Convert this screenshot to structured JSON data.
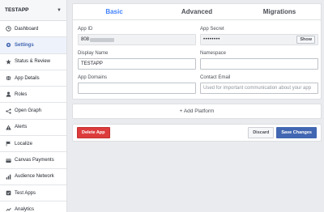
{
  "sidebar": {
    "app_name": "TESTAPP",
    "items": [
      {
        "label": "Dashboard",
        "icon": "clock-icon"
      },
      {
        "label": "Settings",
        "icon": "gear-icon",
        "active": true
      },
      {
        "label": "Status & Review",
        "icon": "star-icon"
      },
      {
        "label": "App Details",
        "icon": "globe-icon"
      },
      {
        "label": "Roles",
        "icon": "person-icon"
      },
      {
        "label": "Open Graph",
        "icon": "open-graph-icon"
      },
      {
        "label": "Alerts",
        "icon": "warning-icon"
      },
      {
        "label": "Localize",
        "icon": "flag-icon"
      },
      {
        "label": "Canvas Payments",
        "icon": "card-icon"
      },
      {
        "label": "Audience Network",
        "icon": "chart-icon"
      },
      {
        "label": "Test Apps",
        "icon": "test-apps-icon"
      },
      {
        "label": "Analytics",
        "icon": "analytics-icon"
      }
    ]
  },
  "tabs": [
    "Basic",
    "Advanced",
    "Migrations"
  ],
  "form": {
    "app_id_label": "App ID",
    "app_id_value": "808",
    "app_secret_label": "App Secret",
    "app_secret_value": "••••••••",
    "show_label": "Show",
    "display_name_label": "Display Name",
    "display_name_value": "TESTAPP",
    "namespace_label": "Namespace",
    "namespace_value": "",
    "app_domains_label": "App Domains",
    "app_domains_value": "",
    "contact_email_label": "Contact Email",
    "contact_email_placeholder": "Used for important communication about your app"
  },
  "add_platform": "+ Add Platform",
  "footer": {
    "delete": "Delete App",
    "discard": "Discard",
    "save": "Save Changes"
  },
  "colors": {
    "accent": "#4267b2",
    "active_tab": "#4080ff",
    "danger": "#dd3c3c"
  }
}
